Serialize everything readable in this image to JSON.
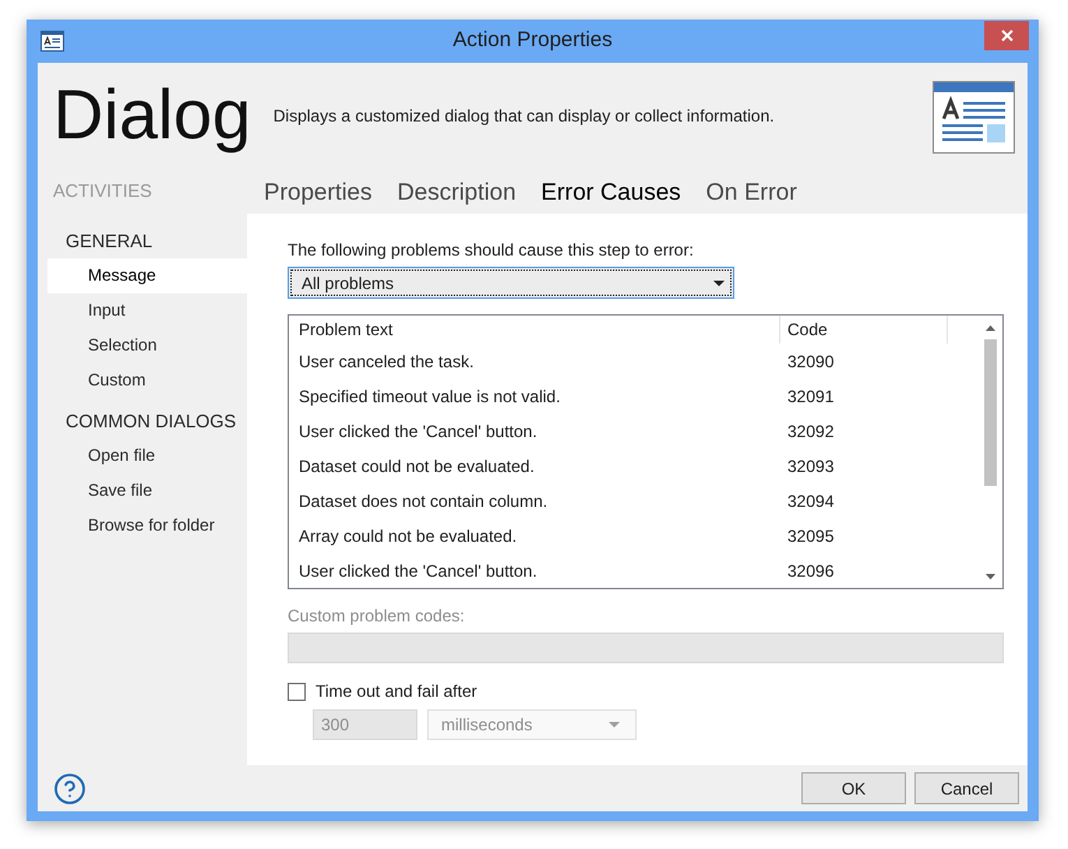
{
  "window": {
    "title": "Action Properties"
  },
  "header": {
    "title": "Dialog",
    "description": "Displays a customized dialog that can display or collect information."
  },
  "sidebar": {
    "heading": "ACTIVITIES",
    "groups": [
      {
        "label": "GENERAL",
        "items": [
          {
            "label": "Message",
            "selected": true
          },
          {
            "label": "Input",
            "selected": false
          },
          {
            "label": "Selection",
            "selected": false
          },
          {
            "label": "Custom",
            "selected": false
          }
        ]
      },
      {
        "label": "COMMON DIALOGS",
        "items": [
          {
            "label": "Open file",
            "selected": false
          },
          {
            "label": "Save file",
            "selected": false
          },
          {
            "label": "Browse for folder",
            "selected": false
          }
        ]
      }
    ]
  },
  "tabs": [
    {
      "label": "Properties",
      "selected": false
    },
    {
      "label": "Description",
      "selected": false
    },
    {
      "label": "Error Causes",
      "selected": true
    },
    {
      "label": "On Error",
      "selected": false
    }
  ],
  "error_causes": {
    "prompt": "The following problems should cause this step to error:",
    "filter": {
      "value": "All problems",
      "focused": true
    },
    "table": {
      "columns": [
        "Problem text",
        "Code"
      ],
      "rows": [
        [
          "User canceled the task.",
          "32090"
        ],
        [
          "Specified timeout value is not valid.",
          "32091"
        ],
        [
          "User clicked the 'Cancel' button.",
          "32092"
        ],
        [
          "Dataset could not be evaluated.",
          "32093"
        ],
        [
          "Dataset does not contain column.",
          "32094"
        ],
        [
          "Array could not be evaluated.",
          "32095"
        ],
        [
          "User clicked the 'Cancel' button.",
          "32096"
        ]
      ]
    },
    "custom_codes": {
      "label": "Custom problem codes:",
      "disabled": true
    },
    "timeout": {
      "label": "Time out and fail after",
      "checked": false,
      "value": "300",
      "unit": "milliseconds",
      "disabled": true
    }
  },
  "buttons": [
    {
      "label": "OK"
    },
    {
      "label": "Cancel"
    }
  ]
}
